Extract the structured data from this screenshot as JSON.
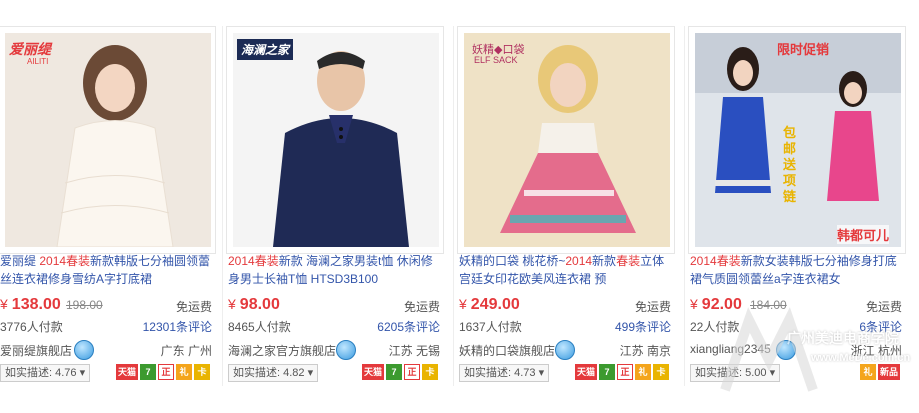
{
  "products": [
    {
      "brand_logo": "爱丽缇",
      "brand_sub": "AILITI",
      "title_pre": "爱丽缇 ",
      "title_hl": "2014春装",
      "title_post": "新款韩版七分袖圆领蕾丝连衣裙修身雪纺A字打底裙",
      "currency": "¥",
      "price": "138.00",
      "orig_price": "198.00",
      "shipping": "免运费",
      "sales": "3776人付款",
      "reviews": "12301条评论",
      "shop": "爱丽缇旗舰店",
      "location": "广东 广州",
      "rating": "如实描述: 4.76",
      "badges": [
        "天猫",
        "7",
        "正",
        "礼",
        "卡"
      ]
    },
    {
      "brand_logo": "海澜之家",
      "title_pre": "",
      "title_hl": "2014春装",
      "title_post": "新款 海澜之家男装t恤 休闲修身男士长袖T恤 HTSD3B100",
      "currency": "¥",
      "price": "98.00",
      "orig_price": "",
      "shipping": "免运费",
      "sales": "8465人付款",
      "reviews": "6205条评论",
      "shop": "海澜之家官方旗舰店",
      "location": "江苏 无锡",
      "rating": "如实描述: 4.82",
      "badges": [
        "天猫",
        "7",
        "正",
        "卡"
      ]
    },
    {
      "brand_logo": "妖精◆口袋",
      "brand_sub": "ELF SACK",
      "title_pre": "妖精的口袋 桃花桥~",
      "title_hl": "2014",
      "title_post": "新款",
      "title_hl2": "春装",
      "title_post2": "立体宫廷女印花欧美风连衣裙 预",
      "currency": "¥",
      "price": "249.00",
      "orig_price": "",
      "shipping": "免运费",
      "sales": "1637人付款",
      "reviews": "499条评论",
      "shop": "妖精的口袋旗舰店",
      "location": "江苏 南京",
      "rating": "如实描述: 4.73",
      "badges": [
        "天猫",
        "7",
        "正",
        "礼",
        "卡"
      ]
    },
    {
      "brand_logo": "限时促销",
      "promo_side": "包邮送项链",
      "promo_bottom": "韩都可儿",
      "title_pre": "",
      "title_hl": "2014春装",
      "title_post": "新款女装韩版七分袖修身打底裙气质圆领蕾丝a字连衣裙女",
      "currency": "¥",
      "price": "92.00",
      "orig_price": "184.00",
      "shipping": "免运费",
      "sales": "22人付款",
      "reviews": "6条评论",
      "shop": "xiangliang2345",
      "location": "浙江 杭州",
      "rating": "如实描述: 5.00",
      "badges": [
        "礼",
        "新品"
      ]
    }
  ],
  "watermark": {
    "line1": "广州美迪电商学院",
    "line2": "www.MeDe.com.cn"
  }
}
